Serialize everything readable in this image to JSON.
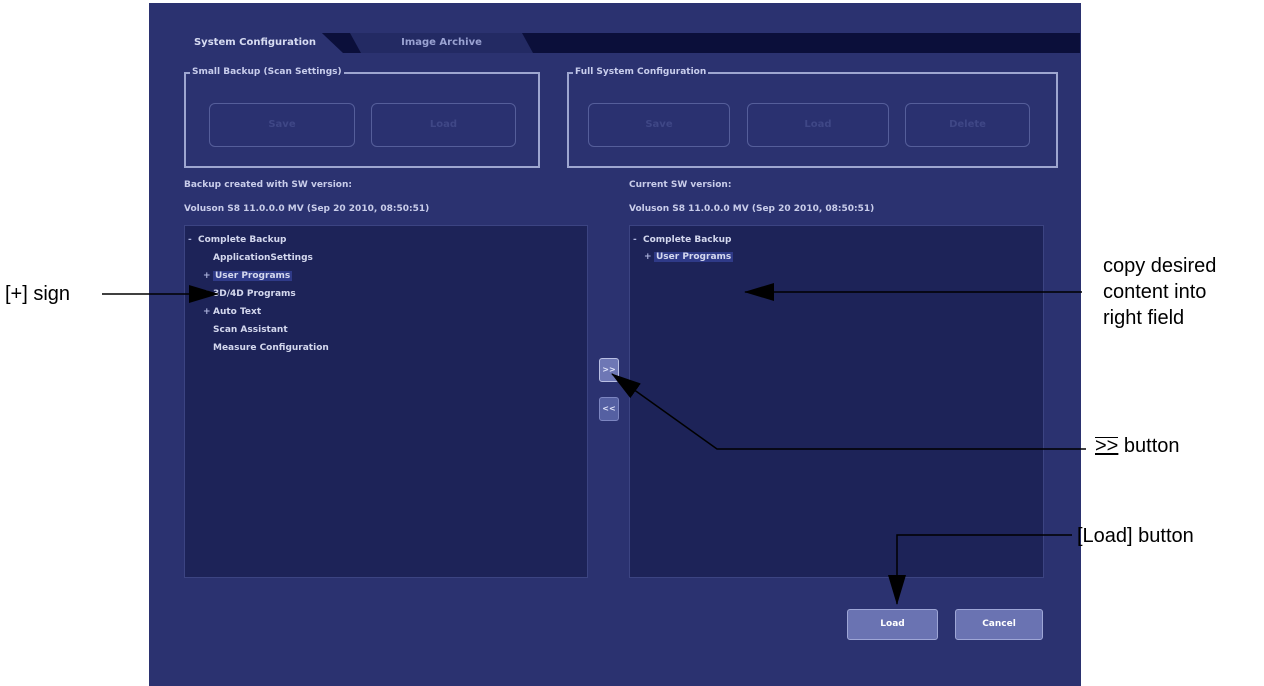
{
  "tabs": [
    {
      "label": "System Configuration",
      "active": true
    },
    {
      "label": "Image Archive",
      "active": false
    }
  ],
  "small_backup": {
    "title": "Small Backup (Scan Settings)",
    "save_label": "Save",
    "load_label": "Load"
  },
  "full_config": {
    "title": "Full System Configuration",
    "save_label": "Save",
    "load_label": "Load",
    "delete_label": "Delete"
  },
  "backup_info": {
    "label": "Backup created with SW version:",
    "version": "Voluson S8 11.0.0.0 MV (Sep 20 2010, 08:50:51)"
  },
  "current_info": {
    "label": "Current SW version:",
    "version": "Voluson S8 11.0.0.0 MV (Sep 20 2010, 08:50:51)"
  },
  "left_tree": {
    "root": "Complete Backup",
    "items": [
      {
        "label": "ApplicationSettings",
        "expander": "",
        "highlight": false
      },
      {
        "label": "User Programs",
        "expander": "+",
        "highlight": true
      },
      {
        "label": "3D/4D Programs",
        "expander": "+",
        "highlight": false
      },
      {
        "label": "Auto Text",
        "expander": "+",
        "highlight": false
      },
      {
        "label": "Scan Assistant",
        "expander": "",
        "highlight": false
      },
      {
        "label": "Measure Configuration",
        "expander": "",
        "highlight": false
      }
    ]
  },
  "right_tree": {
    "root": "Complete Backup",
    "items": [
      {
        "label": "User Programs",
        "expander": "+",
        "highlight": true
      }
    ]
  },
  "transfer": {
    "forward_label": ">>",
    "back_label": "<<"
  },
  "dialog": {
    "load_label": "Load",
    "cancel_label": "Cancel"
  },
  "annotations": {
    "plus_sign": "[+] sign",
    "copy_line1": "copy desired",
    "copy_line2": "content into",
    "copy_line3": "right field",
    "forward_symbol": ">>",
    "forward_text": "button",
    "load_button": "[Load] button"
  },
  "colors": {
    "screen_bg": "#2b3270",
    "panel_bg": "#1d2358",
    "tabbar_bg": "#0b0f3a",
    "button_bg": "#6a73b2"
  }
}
